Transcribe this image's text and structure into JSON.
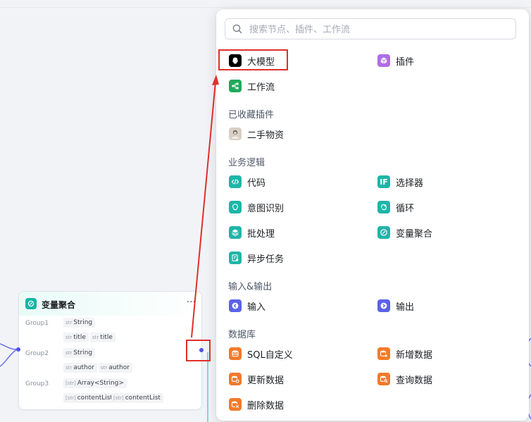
{
  "search": {
    "placeholder": "搜索节点、插件、工作流"
  },
  "top_items": [
    {
      "label": "大模型",
      "icon": "llm-icon"
    },
    {
      "label": "插件",
      "icon": "plugin-cube-icon"
    },
    {
      "label": "工作流",
      "icon": "workflow-icon"
    }
  ],
  "sections": {
    "favorites": "已收藏插件",
    "logic": "业务逻辑",
    "io": "输入&输出",
    "database": "数据库"
  },
  "favorites": [
    {
      "label": "二手物资",
      "icon": "avatar-icon"
    }
  ],
  "logic": [
    {
      "label": "代码",
      "icon": "code-icon"
    },
    {
      "label": "选择器",
      "icon": "selector-icon"
    },
    {
      "label": "意图识别",
      "icon": "intent-icon"
    },
    {
      "label": "循环",
      "icon": "loop-icon"
    },
    {
      "label": "批处理",
      "icon": "batch-icon"
    },
    {
      "label": "变量聚合",
      "icon": "aggregate-icon"
    },
    {
      "label": "异步任务",
      "icon": "async-icon"
    }
  ],
  "io": [
    {
      "label": "输入",
      "icon": "input-icon"
    },
    {
      "label": "输出",
      "icon": "output-icon"
    }
  ],
  "database": [
    {
      "label": "SQL自定义",
      "icon": "db-sql-icon"
    },
    {
      "label": "新增数据",
      "icon": "db-add-icon"
    },
    {
      "label": "更新数据",
      "icon": "db-update-icon"
    },
    {
      "label": "查询数据",
      "icon": "db-query-icon"
    },
    {
      "label": "删除数据",
      "icon": "db-delete-icon"
    }
  ],
  "node": {
    "title": "变量聚合",
    "more": "···",
    "groups": [
      {
        "label": "Group1",
        "type_tag": "str",
        "type": "String",
        "vars": [
          {
            "tag": "str",
            "name": "title"
          },
          {
            "tag": "str",
            "name": "title"
          }
        ]
      },
      {
        "label": "Group2",
        "type_tag": "str",
        "type": "String",
        "vars": [
          {
            "tag": "str",
            "name": "author"
          },
          {
            "tag": "str",
            "name": "author"
          }
        ]
      },
      {
        "label": "Group3",
        "type_tag": "[str]",
        "type": "Array<String>",
        "vars": [
          {
            "tag": "[str]",
            "name": "contentList"
          },
          {
            "tag": "[str]",
            "name": "contentList"
          }
        ]
      }
    ]
  },
  "colors": {
    "highlight": "#e0302b",
    "teal": "#1fb5a8",
    "db_orange": "#f27a2c",
    "io_blue": "#5b62e8"
  }
}
